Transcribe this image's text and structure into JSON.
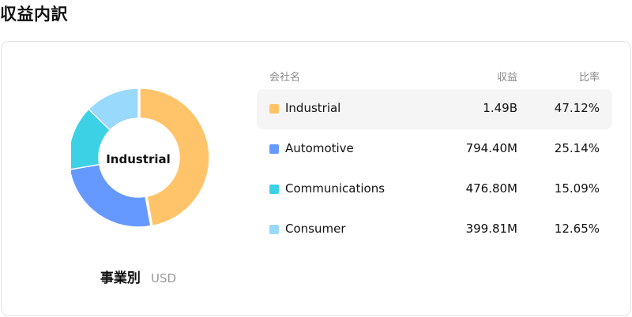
{
  "page": {
    "title": "収益内訳"
  },
  "chart": {
    "center_label": "Industrial",
    "caption_title": "事業別",
    "caption_unit": "USD"
  },
  "table": {
    "headers": {
      "name": "会社名",
      "value": "収益",
      "ratio": "比率"
    }
  },
  "colors": {
    "Industrial": "#FFC46A",
    "Automotive": "#6699FF",
    "Communications": "#3DD1E6",
    "Consumer": "#99D9FC"
  },
  "chart_data": {
    "type": "pie",
    "variant": "donut",
    "categories": [
      "Industrial",
      "Automotive",
      "Communications",
      "Consumer"
    ],
    "values": [
      1.49,
      0.7944,
      0.4768,
      0.39981
    ],
    "value_labels": [
      "1.49B",
      "794.40M",
      "476.80M",
      "399.81M"
    ],
    "percentages": [
      "47.12%",
      "25.14%",
      "15.09%",
      "12.65%"
    ],
    "percent_values": [
      47.12,
      25.14,
      15.09,
      12.65
    ],
    "highlighted": "Industrial"
  }
}
